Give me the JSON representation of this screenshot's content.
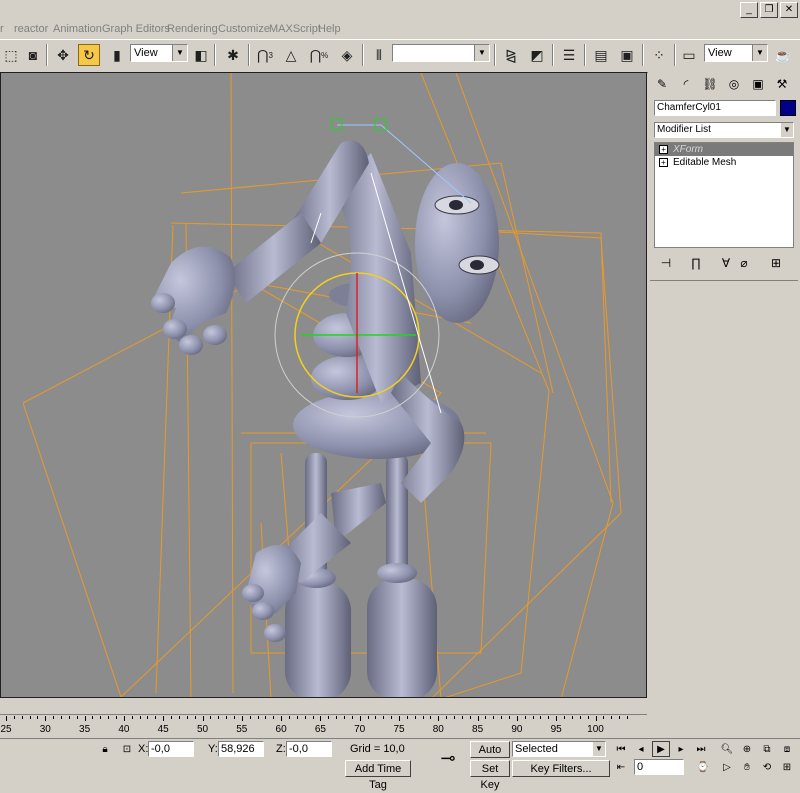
{
  "window": {
    "min": "_",
    "restore": "❐",
    "close": "✕"
  },
  "menu": [
    "r",
    "reactor",
    "Animation",
    "Graph Editors",
    "Rendering",
    "Customize",
    "MAXScript",
    "Help"
  ],
  "toolbar": {
    "refcoord_value": "View",
    "named_sel_value": "",
    "view_value": "View",
    "snap_label": "3",
    "angle_snap_label": "",
    "percent_snap_label": "%"
  },
  "panel": {
    "object_name": "ChamferCyl01",
    "object_color": "#00008b",
    "modifier_list_label": "Modifier List",
    "stack": [
      {
        "label": "XForm",
        "selected": true
      },
      {
        "label": "Editable Mesh",
        "selected": false
      }
    ]
  },
  "timeline": {
    "ticks": [
      "25",
      "30",
      "35",
      "40",
      "45",
      "50",
      "55",
      "60",
      "65",
      "70",
      "75",
      "80",
      "85",
      "90",
      "95",
      "100"
    ]
  },
  "status": {
    "x_label": "X:",
    "x_value": "-0,0",
    "y_label": "Y:",
    "y_value": "58,926",
    "z_label": "Z:",
    "z_value": "-0,0",
    "grid": "Grid = 10,0",
    "add_time_tag": "Add Time Tag",
    "auto_key": "Auto Key",
    "selected_value": "Selected",
    "set_key": "Set Key",
    "key_filters": "Key Filters...",
    "frame_value": "0"
  },
  "colors": {
    "viewport_bg": "#8c8c8c",
    "bbox_orange": "#e89a2a",
    "active_button": "#f5c84a"
  }
}
